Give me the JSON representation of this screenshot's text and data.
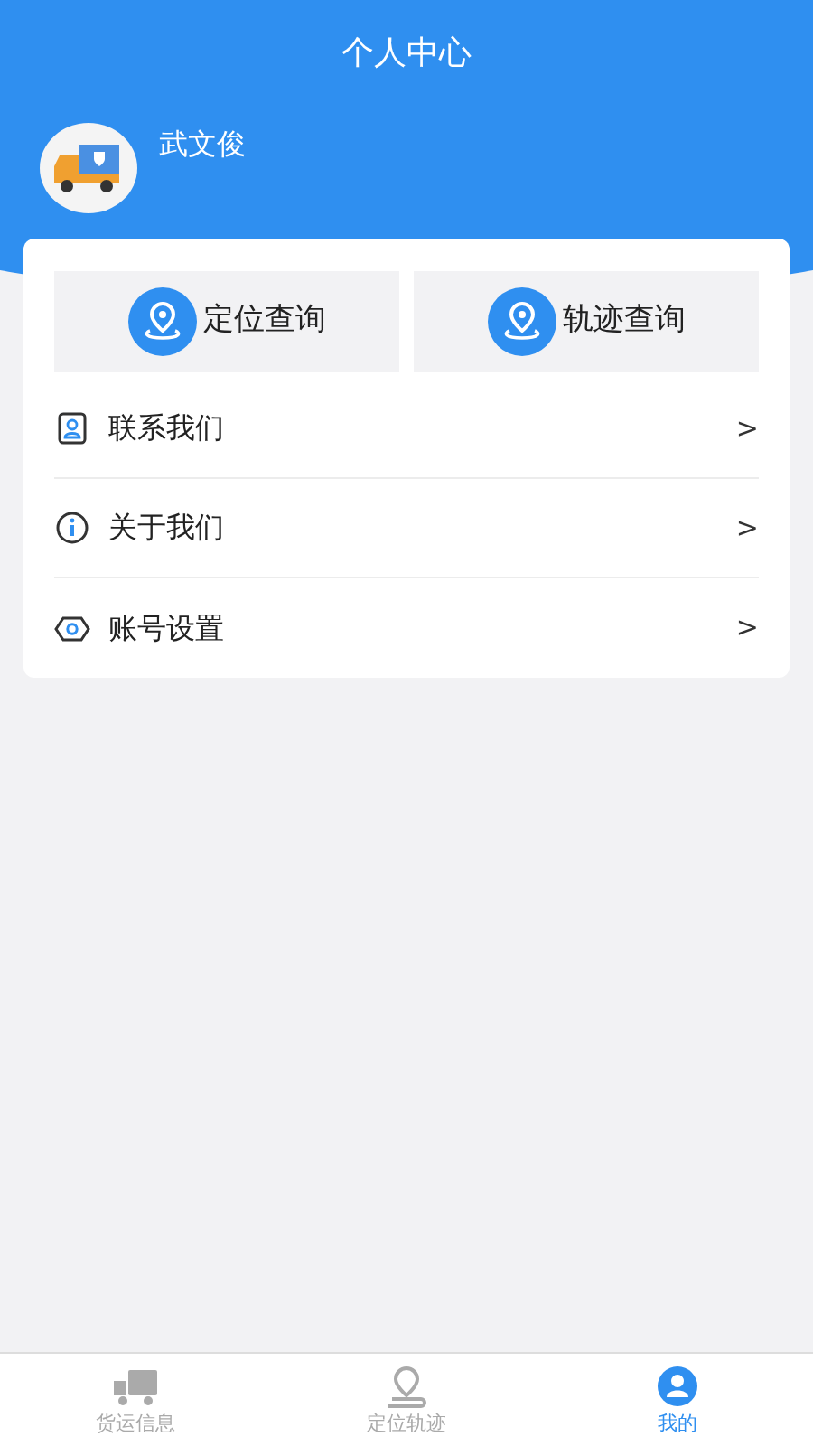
{
  "header": {
    "title": "个人中心"
  },
  "user": {
    "name": "武文俊"
  },
  "quick_actions": [
    {
      "label": "定位查询"
    },
    {
      "label": "轨迹查询"
    }
  ],
  "menu": [
    {
      "label": "联系我们",
      "kind": "contact",
      "chevron": ">"
    },
    {
      "label": "关于我们",
      "kind": "info",
      "chevron": ">"
    },
    {
      "label": "账号设置",
      "kind": "settings",
      "chevron": ">"
    }
  ],
  "tabs": [
    {
      "label": "货运信息",
      "kind": "truck",
      "selected": false
    },
    {
      "label": "定位轨迹",
      "kind": "route",
      "selected": false
    },
    {
      "label": "我的",
      "kind": "person",
      "selected": true
    }
  ]
}
